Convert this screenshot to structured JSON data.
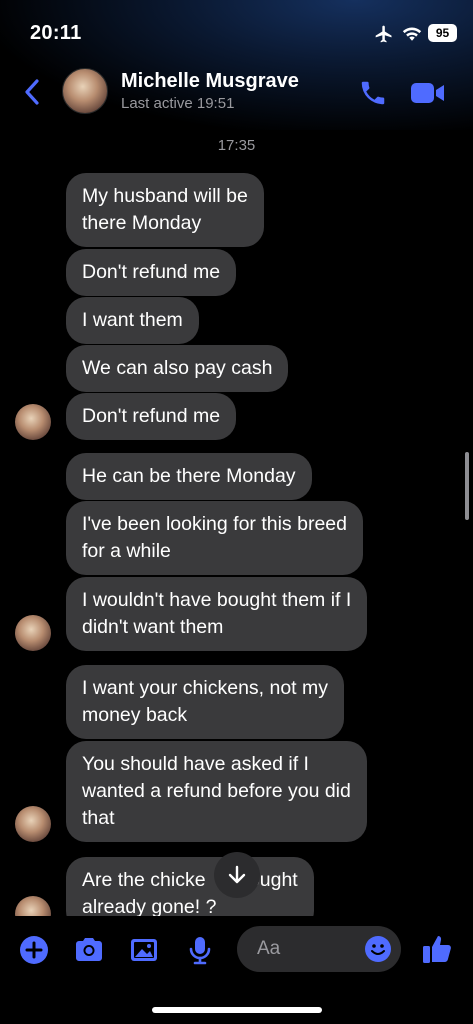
{
  "status_bar": {
    "time": "20:11",
    "battery": "95"
  },
  "header": {
    "name": "Michelle Musgrave",
    "last_active": "Last active 19:51"
  },
  "timestamp": "17:35",
  "messages": [
    "My husband will be\nthere Monday",
    "Don't refund me",
    "I want them",
    "We can also pay cash",
    "Don't refund me",
    "He can be there Monday",
    "I've been looking for this breed\nfor a while",
    "I wouldn't have bought them if I\ndidn't want them",
    "I want your chickens, not my\nmoney back",
    "You should have asked if I\nwanted a refund before you did\nthat",
    "Are the chicke      bought\nalready gone! ?"
  ],
  "composer": {
    "placeholder": "Aa"
  },
  "colors": {
    "accent": "#4f6bff",
    "bubble": "#3a3a3c",
    "background": "#000000"
  }
}
